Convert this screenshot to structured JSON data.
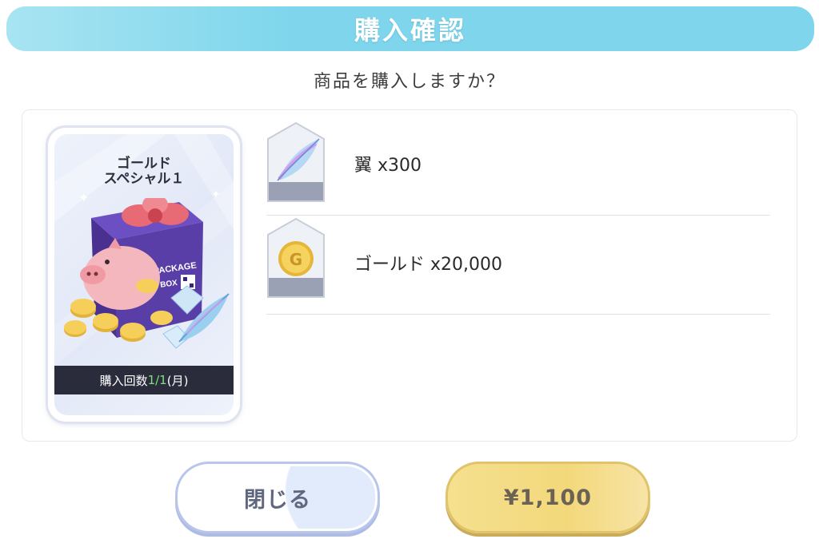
{
  "dialog": {
    "title": "購入確認",
    "question": "商品を購入しますか？"
  },
  "package": {
    "name": "ゴールド\nスペシャル１",
    "purchase_count_prefix": "購入回数",
    "purchase_count_value": "1/1",
    "purchase_count_suffix": "(月)",
    "art_box_text_1": "PACKAGE",
    "art_box_text_2": "BOX",
    "icons": [
      "package-box-icon",
      "piggy-bank-icon",
      "ribbon-bow-icon",
      "gold-coins-icon",
      "crystal-icon",
      "feather-icon"
    ]
  },
  "items": [
    {
      "label": "翼 x300",
      "icon": "wing-feather-icon"
    },
    {
      "label": "ゴールド x20,000",
      "icon": "gold-coin-icon"
    }
  ],
  "buttons": {
    "close_label": "閉じる",
    "buy_label": "¥1,100"
  },
  "colors": {
    "title_bar": "#7fd6ec",
    "buy_button": "#f3d87b",
    "close_button_border": "#b9c6ec",
    "count_highlight": "#7de07c"
  }
}
